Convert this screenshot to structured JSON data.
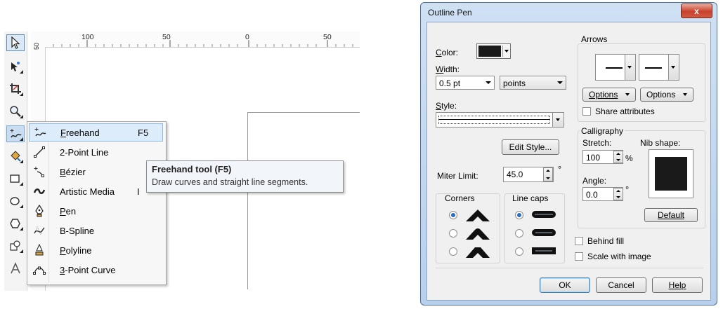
{
  "toolbox": {
    "tools": [
      {
        "icon": "pick-tool-icon"
      },
      {
        "icon": "shape-tool-icon"
      },
      {
        "icon": "crop-tool-icon"
      },
      {
        "icon": "zoom-tool-icon"
      },
      {
        "icon": "freehand-tool-icon"
      },
      {
        "icon": "smart-fill-tool-icon"
      },
      {
        "icon": "rectangle-tool-icon"
      },
      {
        "icon": "ellipse-tool-icon"
      },
      {
        "icon": "polygon-tool-icon"
      },
      {
        "icon": "basic-shapes-tool-icon"
      },
      {
        "icon": "text-tool-icon"
      }
    ]
  },
  "ruler": {
    "labels": [
      "100",
      "50",
      "0",
      "50"
    ],
    "vlabel": "50"
  },
  "flyout": {
    "items": [
      {
        "prefix": "",
        "ul": "F",
        "rest": "reehand",
        "key": "F5",
        "icon": "freehand-icon"
      },
      {
        "prefix": "2-Point Line",
        "ul": "",
        "rest": "",
        "key": "",
        "icon": "two-point-line-icon"
      },
      {
        "prefix": "",
        "ul": "B",
        "rest": "ézier",
        "key": "",
        "icon": "bezier-icon"
      },
      {
        "prefix": "Artistic Media",
        "ul": "",
        "rest": "",
        "key": "I",
        "icon": "artistic-media-icon"
      },
      {
        "prefix": "",
        "ul": "P",
        "rest": "en",
        "key": "",
        "icon": "pen-icon"
      },
      {
        "prefix": "B-Spline",
        "ul": "",
        "rest": "",
        "key": "",
        "icon": "b-spline-icon"
      },
      {
        "prefix": "",
        "ul": "P",
        "rest": "olyline",
        "key": "",
        "icon": "polyline-icon"
      },
      {
        "prefix": "",
        "ul": "3",
        "rest": "-Point Curve",
        "key": "",
        "icon": "three-point-curve-icon"
      }
    ]
  },
  "tooltip": {
    "title": "Freehand tool (F5)",
    "body": "Draw curves and straight line segments."
  },
  "dialog": {
    "title": "Outline Pen",
    "close": "x",
    "color_label": "Color:",
    "width_label": "Width:",
    "width_value": "0.5 pt",
    "units_value": "points",
    "style_label": "Style:",
    "edit_style": "Edit Style...",
    "miter_label": "Miter Limit:",
    "miter_value": "45.0",
    "degree": "°",
    "corners_label": "Corners",
    "linecaps_label": "Line caps",
    "arrows_label": "Arrows",
    "options1": "Options",
    "options2": "Options",
    "share_attributes": "Share attributes",
    "calligraphy_label": "Calligraphy",
    "stretch_label": "Stretch:",
    "stretch_value": "100",
    "percent": "%",
    "nib_label": "Nib shape:",
    "angle_label": "Angle:",
    "angle_value": "0.0",
    "default_btn": "Default",
    "behind_fill": "Behind fill",
    "scale_with_image": "Scale with image",
    "ok": "OK",
    "cancel": "Cancel",
    "help": "Help",
    "colors": {
      "pen_color": "#1a1a1a",
      "accent": "#2a6dbf"
    }
  }
}
